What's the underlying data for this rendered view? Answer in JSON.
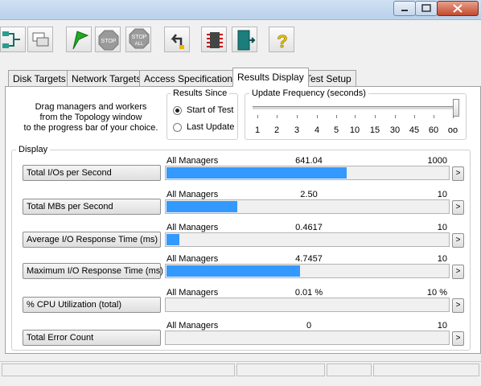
{
  "toolbar": {
    "stop_label": "STOP",
    "stop_all_label": "STOP",
    "stop_all_sub": "ALL",
    "help_glyph": "?"
  },
  "tabs": [
    {
      "label": "Disk Targets"
    },
    {
      "label": "Network Targets"
    },
    {
      "label": "Access Specifications"
    },
    {
      "label": "Results Display"
    },
    {
      "label": "Test Setup"
    }
  ],
  "active_tab": "Results Display",
  "instructions": [
    "Drag managers and workers",
    "from the Topology window",
    "to the progress bar of your choice."
  ],
  "results_since": {
    "legend": "Results Since",
    "options": [
      {
        "label": "Start of Test",
        "selected": true
      },
      {
        "label": "Last Update",
        "selected": false
      }
    ]
  },
  "update_frequency": {
    "legend": "Update Frequency (seconds)",
    "ticks": [
      "1",
      "2",
      "3",
      "4",
      "5",
      "10",
      "15",
      "30",
      "45",
      "60",
      "oo"
    ],
    "selected": "oo"
  },
  "display": {
    "legend": "Display",
    "rows": [
      {
        "button": "Total I/Os per Second",
        "scope": "All Managers",
        "value": "641.04",
        "max": "1000",
        "fill_fraction": 0.641
      },
      {
        "button": "Total MBs per Second",
        "scope": "All Managers",
        "value": "2.50",
        "max": "10",
        "fill_fraction": 0.25
      },
      {
        "button": "Average I/O Response Time (ms)",
        "scope": "All Managers",
        "value": "0.4617",
        "max": "10",
        "fill_fraction": 0.046
      },
      {
        "button": "Maximum I/O Response Time (ms)",
        "scope": "All Managers",
        "value": "4.7457",
        "max": "10",
        "fill_fraction": 0.475
      },
      {
        "button": "% CPU Utilization (total)",
        "scope": "All Managers",
        "value": "0.01 %",
        "max": "10 %",
        "fill_fraction": 0.001
      },
      {
        "button": "Total Error Count",
        "scope": "All Managers",
        "value": "0",
        "max": "10",
        "fill_fraction": 0.0
      }
    ],
    "arrow": ">"
  },
  "colors": {
    "bar_fill": "#3399ff",
    "panel": "#ffffff",
    "window": "#f0f0f0"
  }
}
